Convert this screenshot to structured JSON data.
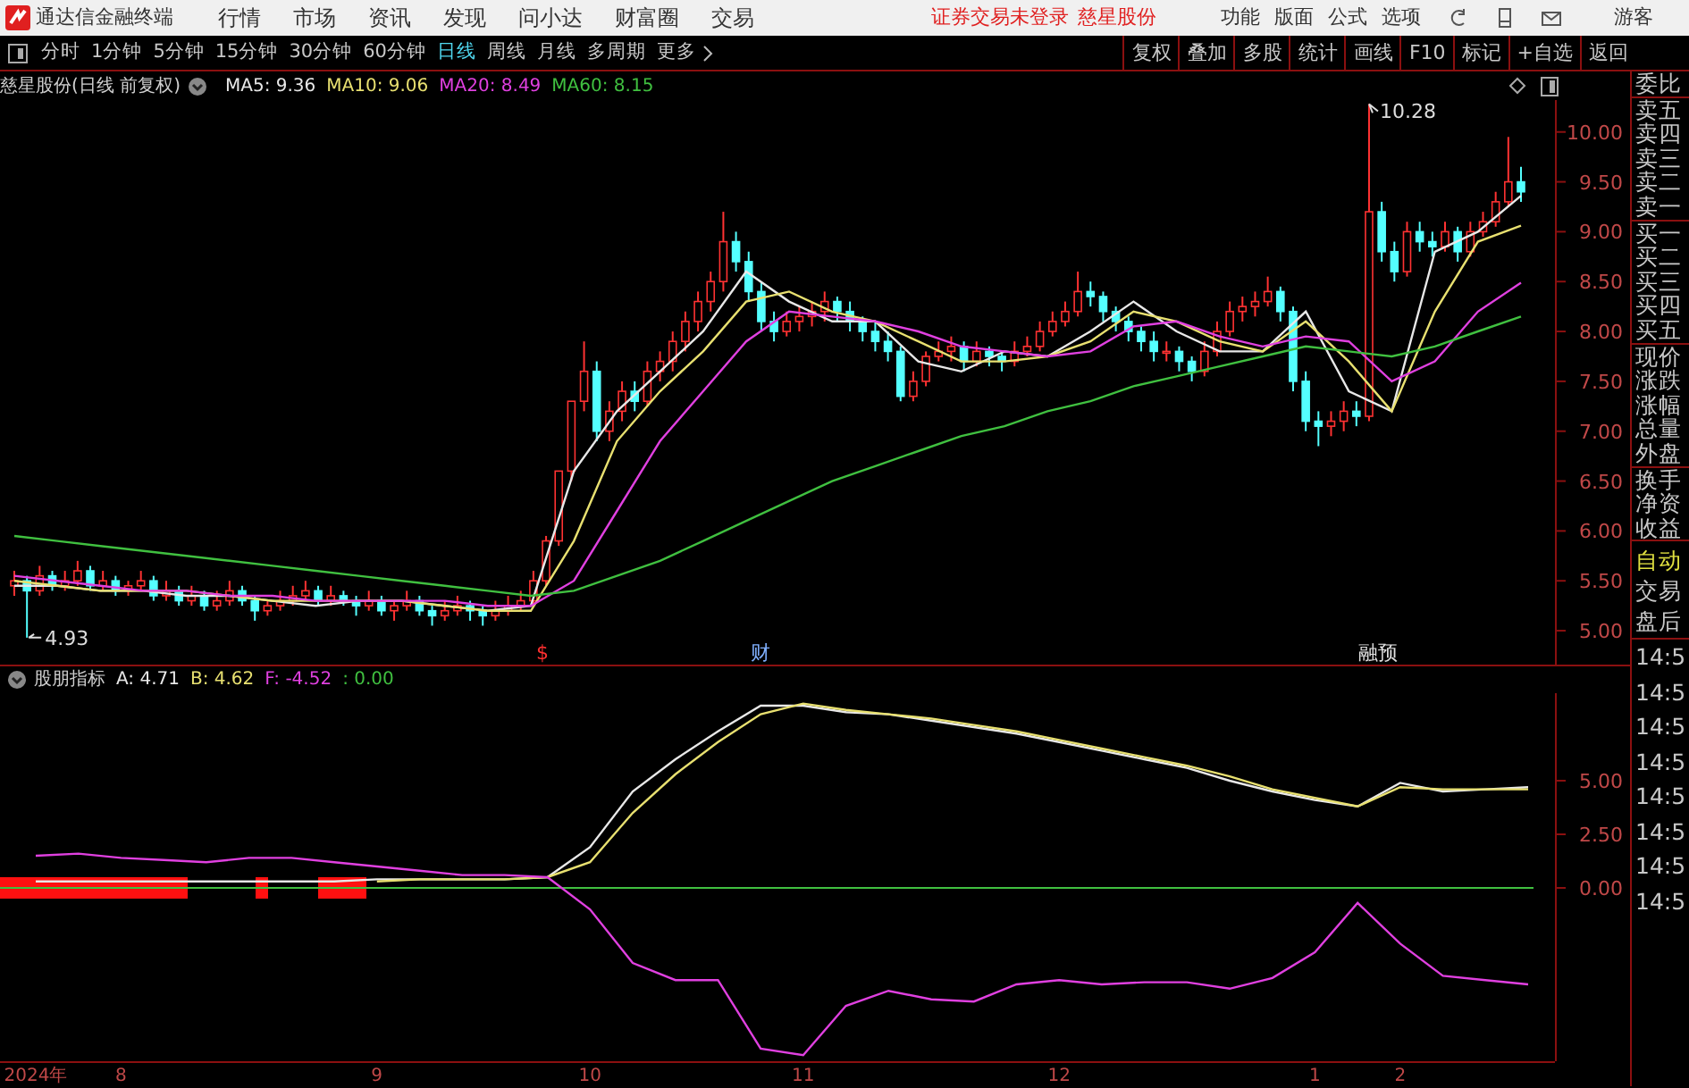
{
  "menubar": {
    "app_title": "通达信金融终端",
    "menus": [
      "行情",
      "市场",
      "资讯",
      "发现",
      "问小达",
      "财富圈",
      "交易"
    ],
    "status_text": "证券交易未登录",
    "stock_link": "慈星股份",
    "tools": [
      "功能",
      "版面",
      "公式",
      "选项"
    ],
    "user": "游客"
  },
  "period_tabs": [
    {
      "label": "分时",
      "selected": false
    },
    {
      "label": "1分钟",
      "selected": false
    },
    {
      "label": "5分钟",
      "selected": false
    },
    {
      "label": "15分钟",
      "selected": false
    },
    {
      "label": "30分钟",
      "selected": false
    },
    {
      "label": "60分钟",
      "selected": false
    },
    {
      "label": "日线",
      "selected": true
    },
    {
      "label": "周线",
      "selected": false
    },
    {
      "label": "月线",
      "selected": false
    },
    {
      "label": "多周期",
      "selected": false
    },
    {
      "label": "更多",
      "selected": false
    }
  ],
  "tool_buttons": [
    "复权",
    "叠加",
    "多股",
    "统计",
    "画线",
    "F10",
    "标记",
    "+自选",
    "返回"
  ],
  "price_chart": {
    "title": "慈星股份(日线 前复权)",
    "indicators": [
      {
        "label": "MA5: 9.36",
        "color": "#e8e8e8"
      },
      {
        "label": "MA10: 9.06",
        "color": "#e8e070"
      },
      {
        "label": "MA20: 8.49",
        "color": "#e040e0"
      },
      {
        "label": "MA60: 8.15",
        "color": "#40c040"
      }
    ],
    "high_label": "10.28",
    "low_label": "4.93",
    "event_marks": [
      {
        "label": "$",
        "color": "#ff3030"
      },
      {
        "label": "财",
        "color": "#80b0ff"
      },
      {
        "label": "融预",
        "color": "#e0e0e0"
      }
    ],
    "candles": {
      "chart_data": {
        "type": "candlestick",
        "ohlc": [
          [
            5.45,
            5.6,
            5.35,
            5.5
          ],
          [
            5.5,
            5.55,
            4.93,
            5.4
          ],
          [
            5.4,
            5.65,
            5.35,
            5.55
          ],
          [
            5.55,
            5.6,
            5.4,
            5.45
          ],
          [
            5.45,
            5.6,
            5.4,
            5.5
          ],
          [
            5.5,
            5.7,
            5.45,
            5.6
          ],
          [
            5.6,
            5.65,
            5.4,
            5.45
          ],
          [
            5.45,
            5.6,
            5.4,
            5.5
          ],
          [
            5.5,
            5.55,
            5.35,
            5.4
          ],
          [
            5.4,
            5.5,
            5.35,
            5.45
          ],
          [
            5.45,
            5.6,
            5.4,
            5.5
          ],
          [
            5.5,
            5.55,
            5.3,
            5.35
          ],
          [
            5.35,
            5.5,
            5.3,
            5.4
          ],
          [
            5.4,
            5.45,
            5.25,
            5.3
          ],
          [
            5.3,
            5.45,
            5.25,
            5.35
          ],
          [
            5.35,
            5.4,
            5.2,
            5.25
          ],
          [
            5.25,
            5.4,
            5.2,
            5.3
          ],
          [
            5.3,
            5.5,
            5.25,
            5.4
          ],
          [
            5.4,
            5.45,
            5.25,
            5.3
          ],
          [
            5.3,
            5.35,
            5.1,
            5.2
          ],
          [
            5.2,
            5.3,
            5.15,
            5.25
          ],
          [
            5.25,
            5.4,
            5.2,
            5.3
          ],
          [
            5.3,
            5.45,
            5.25,
            5.35
          ],
          [
            5.35,
            5.5,
            5.3,
            5.4
          ],
          [
            5.4,
            5.45,
            5.25,
            5.3
          ],
          [
            5.3,
            5.45,
            5.25,
            5.35
          ],
          [
            5.35,
            5.4,
            5.25,
            5.3
          ],
          [
            5.3,
            5.35,
            5.15,
            5.25
          ],
          [
            5.25,
            5.4,
            5.2,
            5.3
          ],
          [
            5.3,
            5.35,
            5.15,
            5.2
          ],
          [
            5.2,
            5.3,
            5.1,
            5.25
          ],
          [
            5.25,
            5.4,
            5.2,
            5.3
          ],
          [
            5.3,
            5.35,
            5.15,
            5.2
          ],
          [
            5.2,
            5.25,
            5.05,
            5.15
          ],
          [
            5.15,
            5.3,
            5.1,
            5.2
          ],
          [
            5.2,
            5.35,
            5.15,
            5.25
          ],
          [
            5.25,
            5.3,
            5.1,
            5.2
          ],
          [
            5.2,
            5.25,
            5.05,
            5.15
          ],
          [
            5.15,
            5.3,
            5.1,
            5.2
          ],
          [
            5.2,
            5.35,
            5.15,
            5.25
          ],
          [
            5.25,
            5.4,
            5.2,
            5.3
          ],
          [
            5.3,
            5.6,
            5.25,
            5.5
          ],
          [
            5.5,
            5.95,
            5.45,
            5.9
          ],
          [
            5.9,
            6.6,
            5.85,
            6.6
          ],
          [
            6.6,
            7.3,
            6.5,
            7.3
          ],
          [
            7.3,
            7.9,
            7.2,
            7.6
          ],
          [
            7.6,
            7.7,
            6.9,
            7.0
          ],
          [
            7.0,
            7.3,
            6.9,
            7.2
          ],
          [
            7.2,
            7.5,
            7.1,
            7.4
          ],
          [
            7.4,
            7.5,
            7.2,
            7.3
          ],
          [
            7.3,
            7.7,
            7.25,
            7.6
          ],
          [
            7.6,
            7.8,
            7.5,
            7.7
          ],
          [
            7.7,
            8.0,
            7.6,
            7.9
          ],
          [
            7.9,
            8.2,
            7.8,
            8.1
          ],
          [
            8.1,
            8.4,
            8.0,
            8.3
          ],
          [
            8.3,
            8.6,
            8.2,
            8.5
          ],
          [
            8.5,
            9.2,
            8.4,
            8.9
          ],
          [
            8.9,
            9.0,
            8.6,
            8.7
          ],
          [
            8.7,
            8.8,
            8.3,
            8.4
          ],
          [
            8.4,
            8.5,
            8.0,
            8.1
          ],
          [
            8.1,
            8.2,
            7.9,
            8.0
          ],
          [
            8.0,
            8.2,
            7.95,
            8.1
          ],
          [
            8.1,
            8.25,
            8.0,
            8.15
          ],
          [
            8.15,
            8.3,
            8.05,
            8.2
          ],
          [
            8.2,
            8.4,
            8.1,
            8.3
          ],
          [
            8.3,
            8.35,
            8.1,
            8.2
          ],
          [
            8.2,
            8.3,
            8.0,
            8.1
          ],
          [
            8.1,
            8.15,
            7.9,
            8.0
          ],
          [
            8.0,
            8.1,
            7.8,
            7.9
          ],
          [
            7.9,
            8.0,
            7.7,
            7.8
          ],
          [
            7.8,
            7.85,
            7.3,
            7.35
          ],
          [
            7.35,
            7.6,
            7.3,
            7.5
          ],
          [
            7.5,
            7.8,
            7.45,
            7.75
          ],
          [
            7.75,
            7.9,
            7.7,
            7.8
          ],
          [
            7.8,
            7.95,
            7.7,
            7.85
          ],
          [
            7.85,
            7.9,
            7.6,
            7.7
          ],
          [
            7.7,
            7.9,
            7.65,
            7.8
          ],
          [
            7.8,
            7.85,
            7.65,
            7.75
          ],
          [
            7.75,
            7.8,
            7.6,
            7.7
          ],
          [
            7.7,
            7.9,
            7.65,
            7.8
          ],
          [
            7.8,
            7.95,
            7.75,
            7.85
          ],
          [
            7.85,
            8.1,
            7.8,
            8.0
          ],
          [
            8.0,
            8.2,
            7.95,
            8.1
          ],
          [
            8.1,
            8.3,
            8.05,
            8.2
          ],
          [
            8.2,
            8.6,
            8.15,
            8.4
          ],
          [
            8.4,
            8.5,
            8.25,
            8.35
          ],
          [
            8.35,
            8.4,
            8.1,
            8.2
          ],
          [
            8.2,
            8.25,
            8.0,
            8.1
          ],
          [
            8.1,
            8.15,
            7.9,
            8.0
          ],
          [
            8.0,
            8.05,
            7.8,
            7.9
          ],
          [
            7.9,
            8.0,
            7.7,
            7.8
          ],
          [
            7.8,
            7.9,
            7.7,
            7.8
          ],
          [
            7.8,
            7.85,
            7.6,
            7.7
          ],
          [
            7.7,
            7.75,
            7.5,
            7.6
          ],
          [
            7.6,
            7.9,
            7.55,
            7.8
          ],
          [
            7.8,
            8.1,
            7.75,
            8.0
          ],
          [
            8.0,
            8.3,
            7.95,
            8.2
          ],
          [
            8.2,
            8.35,
            8.1,
            8.25
          ],
          [
            8.25,
            8.4,
            8.15,
            8.3
          ],
          [
            8.3,
            8.55,
            8.25,
            8.4
          ],
          [
            8.4,
            8.45,
            8.1,
            8.2
          ],
          [
            8.2,
            8.25,
            7.4,
            7.5
          ],
          [
            7.5,
            7.6,
            7.0,
            7.1
          ],
          [
            7.1,
            7.2,
            6.85,
            7.05
          ],
          [
            7.05,
            7.2,
            6.95,
            7.1
          ],
          [
            7.1,
            7.3,
            7.0,
            7.2
          ],
          [
            7.2,
            7.3,
            7.05,
            7.15
          ],
          [
            7.15,
            10.28,
            7.1,
            9.2
          ],
          [
            9.2,
            9.3,
            8.7,
            8.8
          ],
          [
            8.8,
            8.9,
            8.5,
            8.6
          ],
          [
            8.6,
            9.1,
            8.55,
            9.0
          ],
          [
            9.0,
            9.1,
            8.8,
            8.9
          ],
          [
            8.9,
            9.0,
            8.75,
            8.85
          ],
          [
            8.85,
            9.1,
            8.8,
            9.0
          ],
          [
            9.0,
            9.05,
            8.7,
            8.8
          ],
          [
            8.8,
            9.1,
            8.75,
            9.0
          ],
          [
            9.0,
            9.2,
            8.95,
            9.1
          ],
          [
            9.1,
            9.4,
            9.05,
            9.3
          ],
          [
            9.3,
            9.95,
            9.25,
            9.5
          ],
          [
            9.5,
            9.65,
            9.3,
            9.4
          ]
        ]
      }
    },
    "averages": {
      "chart_data": {
        "type": "line",
        "ylim": [
          4.66,
          10.32
        ],
        "yticks": [
          {
            "value": 10,
            "label": "10.00"
          },
          {
            "value": 9.5,
            "label": "9.50"
          },
          {
            "value": 9,
            "label": "9.00"
          },
          {
            "value": 8.5,
            "label": "8.50"
          },
          {
            "value": 8,
            "label": "8.00"
          },
          {
            "value": 7.5,
            "label": "7.50"
          },
          {
            "value": 7,
            "label": "7.00"
          },
          {
            "value": 6.5,
            "label": "6.50"
          },
          {
            "value": 6,
            "label": "6.00"
          },
          {
            "value": 5.5,
            "label": "5.50"
          },
          {
            "value": 5,
            "label": "5.00"
          }
        ],
        "series": [
          {
            "color": "#e8e8e8",
            "values": [
              5.45,
              5.45,
              5.4,
              5.4,
              5.35,
              5.35,
              5.3,
              5.25,
              5.3,
              5.3,
              5.25,
              5.2,
              5.25,
              6.6,
              7.2,
              7.6,
              8.0,
              8.6,
              8.3,
              8.1,
              8.1,
              7.7,
              7.6,
              7.8,
              7.75,
              8.0,
              8.3,
              8.0,
              7.8,
              7.8,
              8.2,
              7.4,
              7.2,
              8.8,
              9.0,
              9.36
            ]
          },
          {
            "color": "#e8e070",
            "values": [
              5.5,
              5.45,
              5.4,
              5.4,
              5.4,
              5.35,
              5.3,
              5.3,
              5.3,
              5.3,
              5.25,
              5.2,
              5.2,
              5.9,
              6.9,
              7.4,
              7.8,
              8.3,
              8.4,
              8.2,
              8.1,
              7.9,
              7.7,
              7.7,
              7.75,
              7.9,
              8.2,
              8.1,
              7.9,
              7.8,
              8.1,
              7.7,
              7.2,
              8.2,
              8.9,
              9.06
            ]
          },
          {
            "color": "#e040e0",
            "values": [
              5.55,
              5.5,
              5.45,
              5.4,
              5.4,
              5.35,
              5.35,
              5.3,
              5.3,
              5.3,
              5.3,
              5.25,
              5.25,
              5.5,
              6.2,
              6.9,
              7.4,
              7.9,
              8.2,
              8.15,
              8.1,
              8.0,
              7.85,
              7.8,
              7.75,
              7.8,
              8.05,
              8.1,
              7.95,
              7.85,
              7.95,
              7.9,
              7.5,
              7.7,
              8.2,
              8.49
            ]
          },
          {
            "color": "#40c040",
            "values": [
              5.95,
              5.9,
              5.85,
              5.8,
              5.75,
              5.7,
              5.65,
              5.6,
              5.55,
              5.5,
              5.45,
              5.4,
              5.35,
              5.4,
              5.55,
              5.7,
              5.9,
              6.1,
              6.3,
              6.5,
              6.65,
              6.8,
              6.95,
              7.05,
              7.2,
              7.3,
              7.45,
              7.55,
              7.65,
              7.75,
              7.85,
              7.8,
              7.75,
              7.85,
              8.0,
              8.15
            ]
          }
        ]
      }
    }
  },
  "indicator_panel": {
    "title": "股朋指标",
    "values": [
      {
        "label": "A: 4.71",
        "color": "#e8e8e8"
      },
      {
        "label": "B: 4.62",
        "color": "#e8e070"
      },
      {
        "label": "F: -4.52",
        "color": "#e040e0"
      },
      {
        "label": ": 0.00",
        "color": "#40c040"
      }
    ],
    "chart_data": {
      "type": "line",
      "ylim": [
        -8.08,
        9.08
      ],
      "categories": [
        "2024年",
        null,
        "8",
        null,
        null,
        null,
        null,
        null,
        "9",
        null,
        null,
        null,
        null,
        "10",
        null,
        null,
        null,
        null,
        "11",
        null,
        null,
        null,
        null,
        null,
        "12",
        null,
        null,
        null,
        null,
        null,
        "1",
        null,
        "2",
        null,
        null,
        null
      ],
      "yticks": [
        {
          "value": 5,
          "label": "5.00"
        },
        {
          "value": 2.5,
          "label": "2.50"
        },
        {
          "value": 0,
          "label": "0.00"
        }
      ],
      "series": [
        {
          "color": "#e8e8e8",
          "values": [
            0.3,
            0.3,
            0.3,
            0.3,
            0.3,
            0.3,
            0.3,
            0.3,
            0.4,
            0.4,
            0.4,
            0.4,
            0.5,
            1.9,
            4.5,
            6.0,
            7.3,
            8.5,
            8.5,
            8.2,
            8.1,
            7.8,
            7.5,
            7.2,
            6.8,
            6.4,
            6.0,
            5.6,
            5.0,
            4.5,
            4.1,
            3.8,
            4.9,
            4.5,
            4.6,
            4.7
          ]
        },
        {
          "color": "#e8e070",
          "values": [
            null,
            null,
            null,
            null,
            null,
            null,
            null,
            null,
            0.3,
            0.4,
            0.4,
            0.4,
            0.5,
            1.2,
            3.5,
            5.3,
            6.8,
            8.1,
            8.6,
            8.3,
            8.1,
            7.9,
            7.6,
            7.3,
            6.9,
            6.5,
            6.1,
            5.7,
            5.2,
            4.6,
            4.2,
            3.8,
            4.7,
            4.6,
            4.6,
            4.6
          ]
        },
        {
          "color": "#e040e0",
          "values": [
            1.5,
            1.6,
            1.4,
            1.3,
            1.2,
            1.4,
            1.4,
            1.2,
            1.0,
            0.8,
            0.6,
            0.6,
            0.5,
            -1.0,
            -3.5,
            -4.3,
            -4.3,
            -7.5,
            -7.8,
            -5.5,
            -4.8,
            -5.2,
            -5.3,
            -4.5,
            -4.3,
            -4.5,
            -4.4,
            -4.4,
            -4.7,
            -4.2,
            -3.0,
            -0.7,
            -2.6,
            -4.1,
            -4.3,
            -4.5
          ]
        }
      ]
    }
  },
  "quote_panel": {
    "groups": [
      [
        "委比"
      ],
      [
        "卖五",
        "卖四",
        "卖三",
        "卖二",
        "卖一"
      ],
      [
        "买一",
        "买二",
        "买三",
        "买四",
        "买五"
      ],
      [
        "现价",
        "涨跌",
        "涨幅",
        "总量",
        "外盘"
      ],
      [
        "换手",
        "净资",
        "收益"
      ]
    ],
    "modes": [
      {
        "label": "自动",
        "highlighted": true
      },
      {
        "label": "交易",
        "highlighted": false
      },
      {
        "label": "盘后",
        "highlighted": false
      }
    ],
    "times": [
      "14:5",
      "14:5",
      "14:5",
      "14:5",
      "14:5",
      "14:5",
      "14:5",
      "14:5"
    ]
  }
}
